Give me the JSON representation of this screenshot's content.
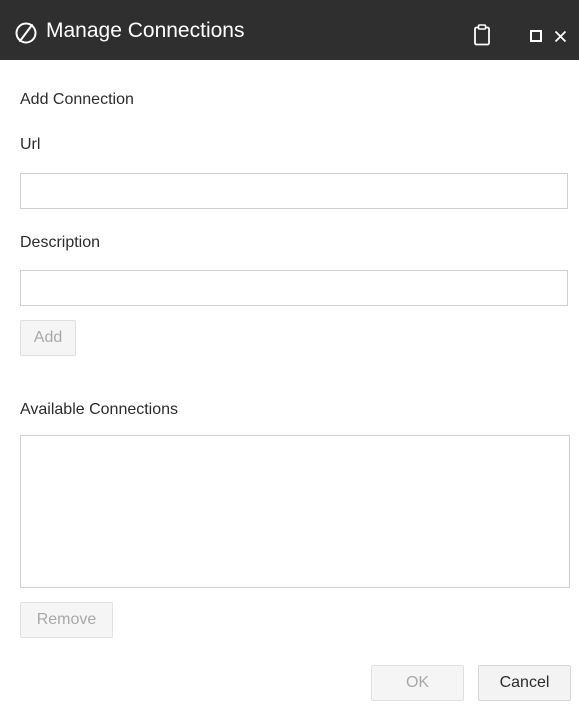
{
  "window": {
    "title": "Manage Connections",
    "logo_icon": "oracle-logo-icon",
    "clipboard_icon": "clipboard-icon",
    "maximize_icon": "maximize-icon",
    "close_icon": "close-icon",
    "titlebar_color": "#2f2f2f"
  },
  "add_section": {
    "heading": "Add Connection",
    "url_label": "Url",
    "url_value": "",
    "description_label": "Description",
    "description_value": "",
    "add_button": "Add"
  },
  "available_section": {
    "heading": "Available Connections",
    "items": [],
    "remove_button": "Remove"
  },
  "footer": {
    "ok_button": "OK",
    "cancel_button": "Cancel"
  }
}
